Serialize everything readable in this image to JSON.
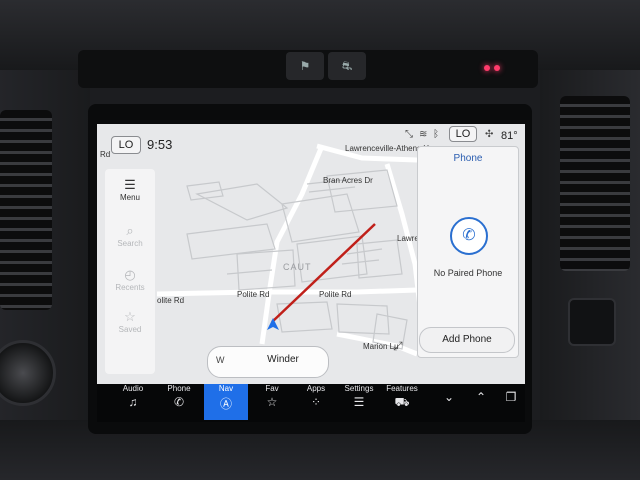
{
  "status_bar": {
    "lo_left": "LO",
    "time": "9:53",
    "lo_right": "LO",
    "temperature": "81°"
  },
  "side_menu": {
    "menu_label": "Menu",
    "search_label": "Search",
    "recents_label": "Recents",
    "favorites_label": "Saved"
  },
  "map": {
    "road_top": "Lawrenceville-Athens Hwy",
    "road_brantley": "Bran  Acres Dr",
    "road_lawre": "Lawre",
    "road_polite_left": "olite Rd",
    "road_polite_center": "Polite Rd",
    "road_polite_right": "Polite Rd",
    "road_marion": "Marion Lu",
    "road_rd": "Rd",
    "label_faint": "CAUT"
  },
  "route_chip": {
    "direction": "W",
    "destination": "Winder"
  },
  "phone_panel": {
    "title": "Phone",
    "status": "No Paired Phone",
    "add_button": "Add Phone"
  },
  "dock": {
    "items": [
      {
        "label": "Audio",
        "icon": "♫"
      },
      {
        "label": "Phone",
        "icon": "✆"
      },
      {
        "label": "Nav",
        "icon": "Ⓐ"
      },
      {
        "label": "Fav",
        "icon": "☆"
      },
      {
        "label": "Apps",
        "icon": "⁘"
      },
      {
        "label": "Settings",
        "icon": "☰"
      },
      {
        "label": "Features",
        "icon": "⛟"
      }
    ]
  },
  "colors": {
    "accent": "#1f6fe8",
    "route_line": "#c0201a",
    "phone_title": "#2a5db0"
  }
}
